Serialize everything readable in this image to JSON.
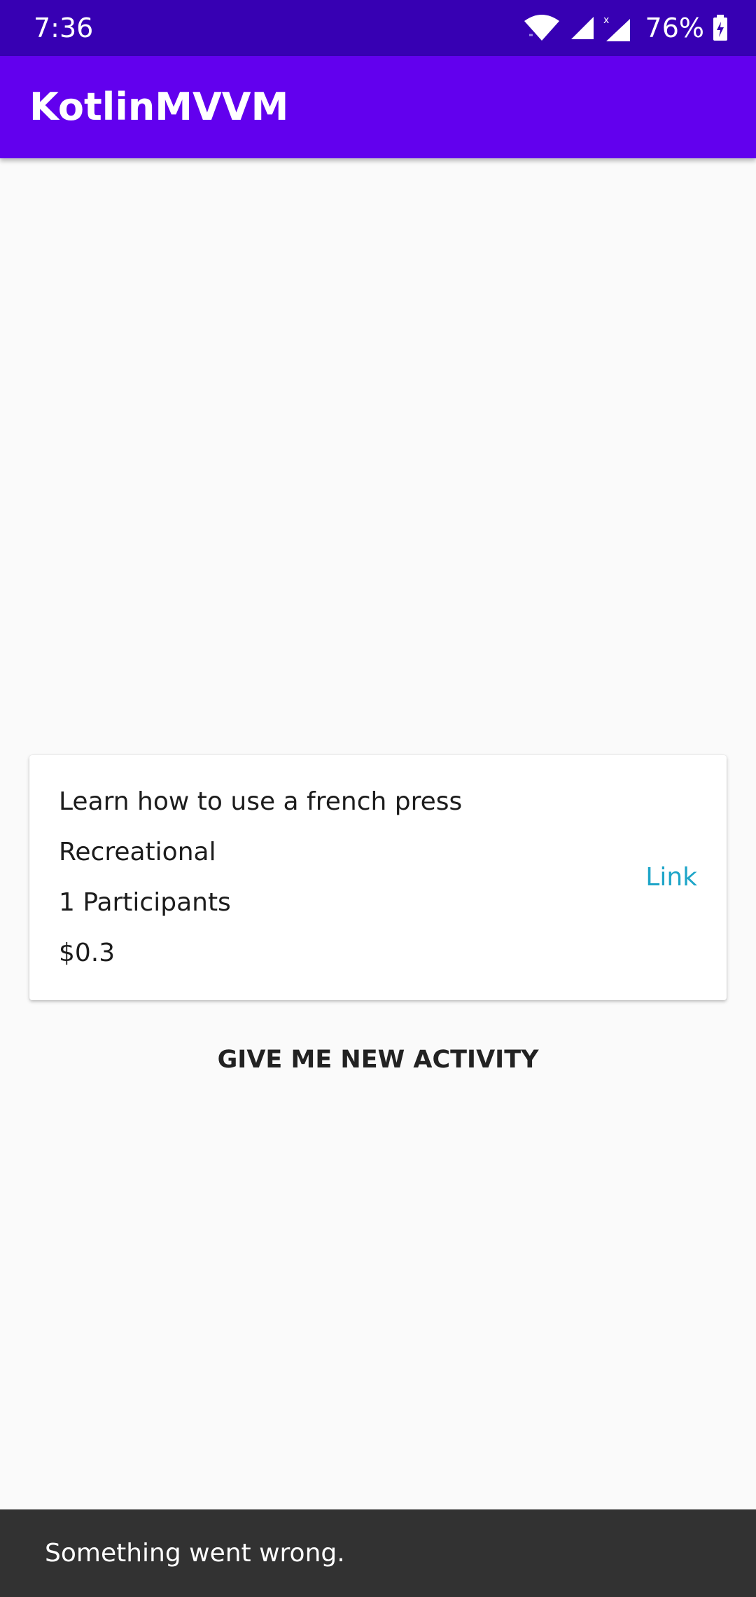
{
  "status_bar": {
    "time": "7:36",
    "battery_percent": "76%",
    "icons": [
      "wifi-icon",
      "signal-icon",
      "signal-x-icon",
      "battery-charging-icon"
    ]
  },
  "app_bar": {
    "title": "KotlinMVVM"
  },
  "activity_card": {
    "activity": "Learn how to use a french press",
    "type": "Recreational",
    "participants": "1 Participants",
    "price": "$0.3",
    "link_label": "Link"
  },
  "actions": {
    "new_activity_label": "GIVE ME NEW ACTIVITY"
  },
  "snackbar": {
    "message": "Something went wrong."
  },
  "colors": {
    "status_bar": "#3700b3",
    "app_bar": "#6200ee",
    "background": "#fafafa",
    "link": "#1ea5c8",
    "snackbar": "#323232"
  }
}
